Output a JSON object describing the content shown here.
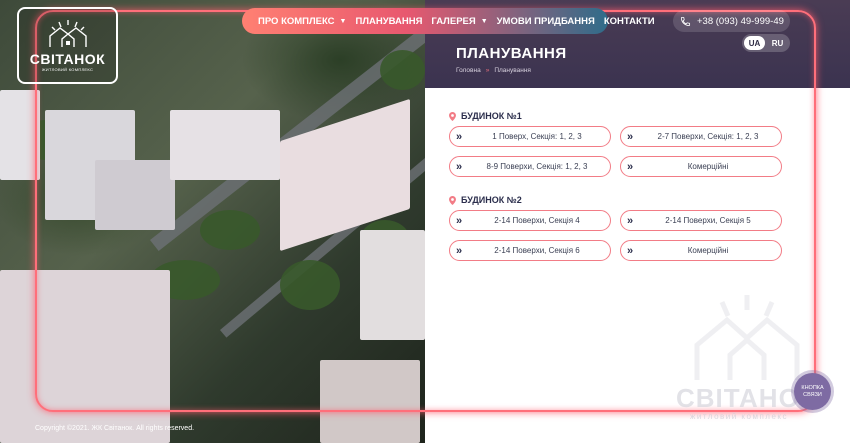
{
  "logo": {
    "name": "СВІТАНОК",
    "subtitle": "житловий комплекс"
  },
  "nav": {
    "items": [
      {
        "label": "ПРО КОМПЛЕКС",
        "dropdown": true
      },
      {
        "label": "ПЛАНУВАННЯ",
        "dropdown": false
      },
      {
        "label": "ГАЛЕРЕЯ",
        "dropdown": true
      },
      {
        "label": "УМОВИ ПРИДБАННЯ",
        "dropdown": false
      },
      {
        "label": "КОНТАКТИ",
        "dropdown": false
      }
    ]
  },
  "phone": {
    "icon": "phone-icon",
    "number": "+38 (093) 49-999-49"
  },
  "languages": {
    "options": [
      "UA",
      "RU"
    ],
    "active": "UA"
  },
  "header": {
    "title": "ПЛАНУВАННЯ",
    "breadcrumb": [
      "Головна",
      "Планування"
    ],
    "separator": "»"
  },
  "sections": [
    {
      "title": "БУДИНОК №1",
      "buttons": [
        "1 Поверх, Секція: 1, 2, 3",
        "2-7 Поверхи, Секція: 1, 2, 3",
        "8-9 Поверхи, Секція: 1, 2, 3",
        "Комерційні"
      ]
    },
    {
      "title": "БУДИНОК №2",
      "buttons": [
        "2-14 Поверхи, Секція 4",
        "2-14 Поверхи, Секція 5",
        "2-14 Поверхи, Секція 6",
        "Комерційні"
      ]
    }
  ],
  "button_arrow": "»",
  "watermark": {
    "name": "СВІТАНОК",
    "subtitle": "житловий комплекс"
  },
  "contact_button": {
    "line1": "КНОПКА",
    "line2": "СВЯЗИ"
  },
  "footer": {
    "copyright": "Copyright ©2021. ЖК Світанок. All rights reserved."
  },
  "colors": {
    "accent": "#f27c86",
    "dark": "#2b2e4c",
    "header_bg": "#3b3350",
    "nav_start": "#ff8072",
    "nav_end": "#2f6c8a"
  }
}
